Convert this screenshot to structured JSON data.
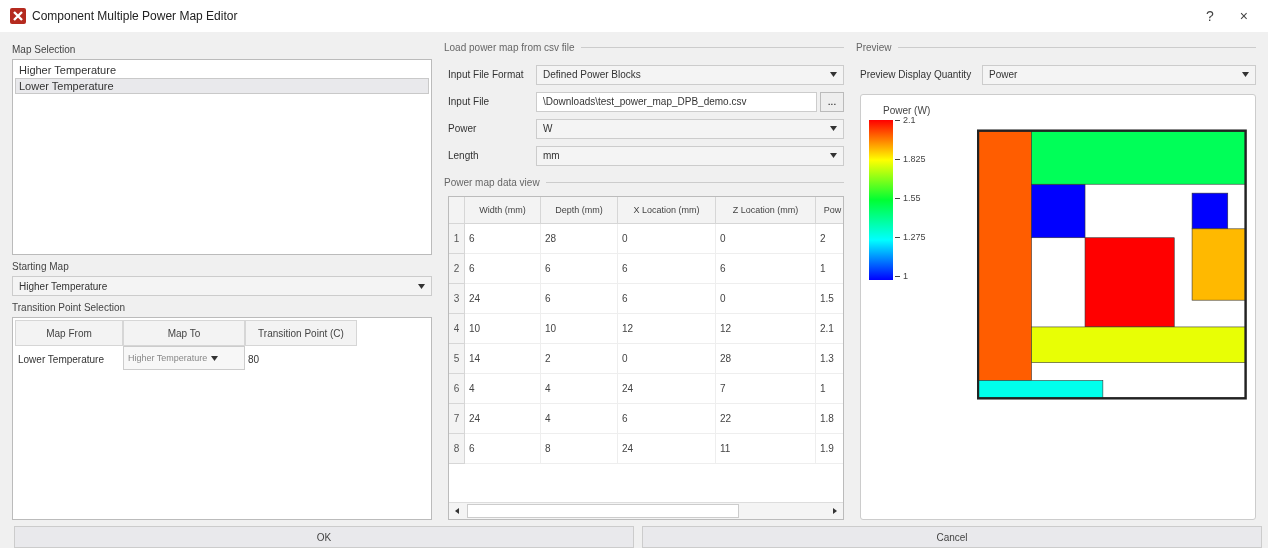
{
  "window": {
    "title": "Component Multiple Power Map Editor",
    "help": "?",
    "close": "×"
  },
  "map_selection": {
    "label": "Map Selection",
    "items": [
      {
        "label": "Higher Temperature",
        "selected": false
      },
      {
        "label": "Lower Temperature",
        "selected": true
      }
    ]
  },
  "starting_map": {
    "label": "Starting Map",
    "value": "Higher Temperature"
  },
  "transition": {
    "label": "Transition Point Selection",
    "columns": [
      "Map From",
      "Map To",
      "Transition Point (C)"
    ],
    "rows": [
      {
        "map_from": "Lower Temperature",
        "map_to": {
          "value": "Higher Temperature",
          "disabled": true
        },
        "transition_point": "80"
      }
    ]
  },
  "load_csv": {
    "legend": "Load power map from csv file",
    "fields": [
      {
        "kind": "select",
        "label": "Input File Format",
        "value": "Defined Power Blocks"
      },
      {
        "kind": "file",
        "label": "Input File",
        "value": "\\Downloads\\test_power_map_DPB_demo.csv",
        "browse": "..."
      },
      {
        "kind": "select",
        "label": "Power",
        "value": "W"
      },
      {
        "kind": "select",
        "label": "Length",
        "value": "mm"
      }
    ]
  },
  "data_view": {
    "legend": "Power map data view",
    "columns": [
      "Width (mm)",
      "Depth (mm)",
      "X Location (mm)",
      "Z Location (mm)",
      "Pow"
    ],
    "rows": [
      {
        "number": "1",
        "cells": [
          "6",
          "28",
          "0",
          "0",
          "2"
        ]
      },
      {
        "number": "2",
        "cells": [
          "6",
          "6",
          "6",
          "6",
          "1"
        ]
      },
      {
        "number": "3",
        "cells": [
          "24",
          "6",
          "6",
          "0",
          "1.5"
        ]
      },
      {
        "number": "4",
        "cells": [
          "10",
          "10",
          "12",
          "12",
          "2.1"
        ]
      },
      {
        "number": "5",
        "cells": [
          "14",
          "2",
          "0",
          "28",
          "1.3"
        ]
      },
      {
        "number": "6",
        "cells": [
          "4",
          "4",
          "24",
          "7",
          "1"
        ]
      },
      {
        "number": "7",
        "cells": [
          "24",
          "4",
          "6",
          "22",
          "1.8"
        ]
      },
      {
        "number": "8",
        "cells": [
          "6",
          "8",
          "24",
          "11",
          "1.9"
        ]
      }
    ]
  },
  "preview": {
    "legend": "Preview",
    "quantity_label": "Preview Display Quantity",
    "quantity_value": "Power",
    "colorbar": {
      "title": "Power (W)",
      "ticks": [
        "2.1",
        "1.825",
        "1.55",
        "1.275",
        "1"
      ]
    }
  },
  "buttons": [
    {
      "label": "OK"
    },
    {
      "label": "Cancel"
    }
  ]
}
